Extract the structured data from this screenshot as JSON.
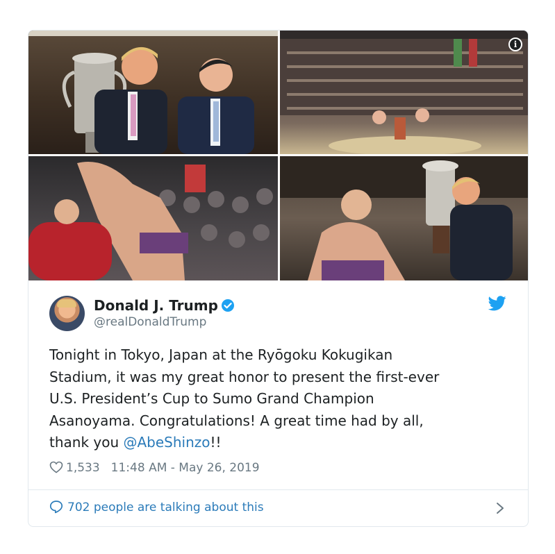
{
  "tweet": {
    "author_name": "Donald J. Trump",
    "author_handle": "@realDonaldTrump",
    "text_before": "Tonight in Tokyo, Japan at the Ryōgoku Kokugikan\nStadium, it was my great honor to present the first-ever\nU.S. President’s Cup to Sumo Grand Champion\nAsanoyama. Congratulations! A great time had by all,\nthank you ",
    "mention": "@AbeShinzo",
    "text_after": "!!",
    "likes": "1,533",
    "timestamp": "11:48 AM - May 26, 2019",
    "talking": "702 people are talking about this"
  },
  "media": {
    "info_label": "i"
  },
  "colors": {
    "link": "#2b7bb9",
    "verified": "#1da1f2",
    "twitter_brand": "#1da1f2",
    "secondary_text": "#697882",
    "border": "#e1e8ed"
  },
  "icons": [
    "info-icon",
    "verified-icon",
    "twitter-bird-icon",
    "heart-icon",
    "speech-bubble-icon",
    "chevron-right-icon"
  ]
}
